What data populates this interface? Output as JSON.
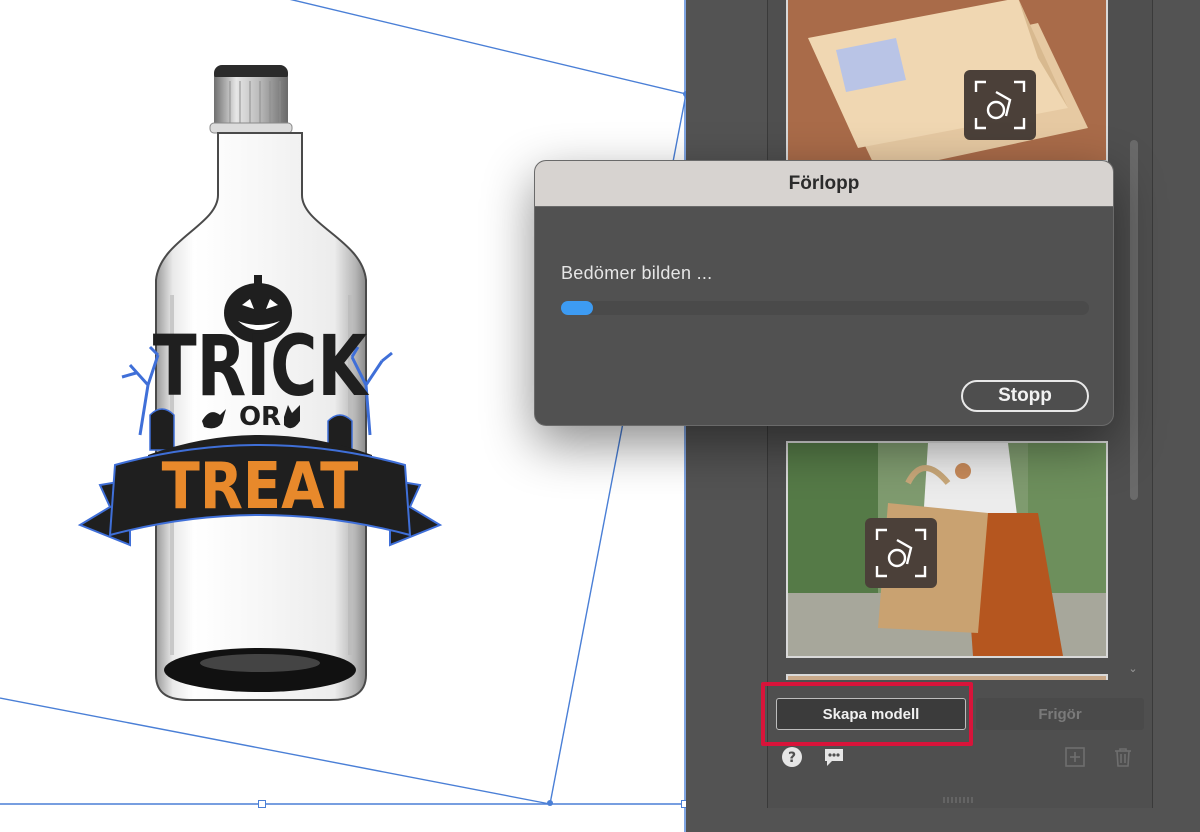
{
  "dialog": {
    "title": "Förlopp",
    "status_text": "Bedömer bilden ...",
    "progress_fraction": 0.06,
    "stop_label": "Stopp"
  },
  "panel": {
    "create_model_label": "Skapa modell",
    "release_label": "Frigör"
  },
  "artwork": {
    "line1": "TRICK",
    "line2": "OR",
    "line3": "TREAT"
  },
  "colors": {
    "selection": "#4a7fd6",
    "progress": "#3d9bf2",
    "highlight": "#d8143a",
    "treat_orange": "#e8892b",
    "ink": "#1f1f1f"
  },
  "icons": {
    "help": "question-circle-icon",
    "feedback": "speech-bubble-icon",
    "new": "add-square-icon",
    "delete": "trash-icon",
    "model_badge": "3d-model-badge-icon"
  }
}
